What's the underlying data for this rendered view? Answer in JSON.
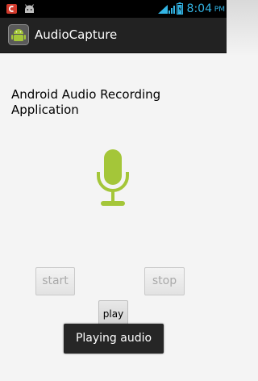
{
  "status_bar": {
    "time": "8:04",
    "ampm": "PM",
    "icons": [
      "notification-icon",
      "android-debug-icon",
      "wifi-icon",
      "signal-icon",
      "battery-icon"
    ]
  },
  "action_bar": {
    "title": "AudioCapture",
    "icon": "android-app-icon"
  },
  "main": {
    "heading": "Android Audio Recording Application",
    "icon": "microphone-icon",
    "buttons": {
      "start": "start",
      "stop": "stop",
      "play": "play"
    }
  },
  "toast": {
    "message": "Playing audio"
  },
  "colors": {
    "status_time": "#33b5e5",
    "action_bar": "#222222",
    "mic": "#a4c639",
    "disabled_text": "#a9a9a9"
  }
}
